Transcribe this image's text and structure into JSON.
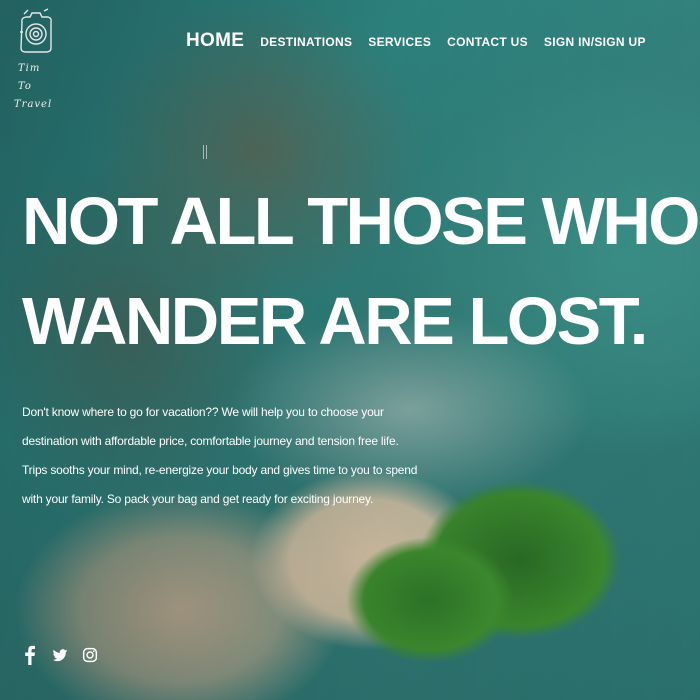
{
  "brand": {
    "line1": "Tim To",
    "line2": "Travel"
  },
  "nav": {
    "items": [
      {
        "label": "HOME"
      },
      {
        "label": "DESTINATIONS"
      },
      {
        "label": "SERVICES"
      },
      {
        "label": "CONTACT US"
      },
      {
        "label": "SIGN IN/SIGN UP"
      }
    ]
  },
  "hero": {
    "headline_line1": "NOT ALL THOSE WHO",
    "headline_line2": "WANDER ARE LOST.",
    "description_lines": [
      "Don't know where to go for vacation?? We will help you to choose your",
      "destination with affordable price, comfortable journey and tension free life.",
      "Trips sooths your mind, re-energize your body and gives time to you to spend",
      "with your family. So pack your bag and get ready for exciting journey."
    ]
  },
  "social": {
    "icons": [
      "facebook-icon",
      "twitter-icon",
      "instagram-icon"
    ]
  },
  "colors": {
    "text": "#ffffff"
  }
}
